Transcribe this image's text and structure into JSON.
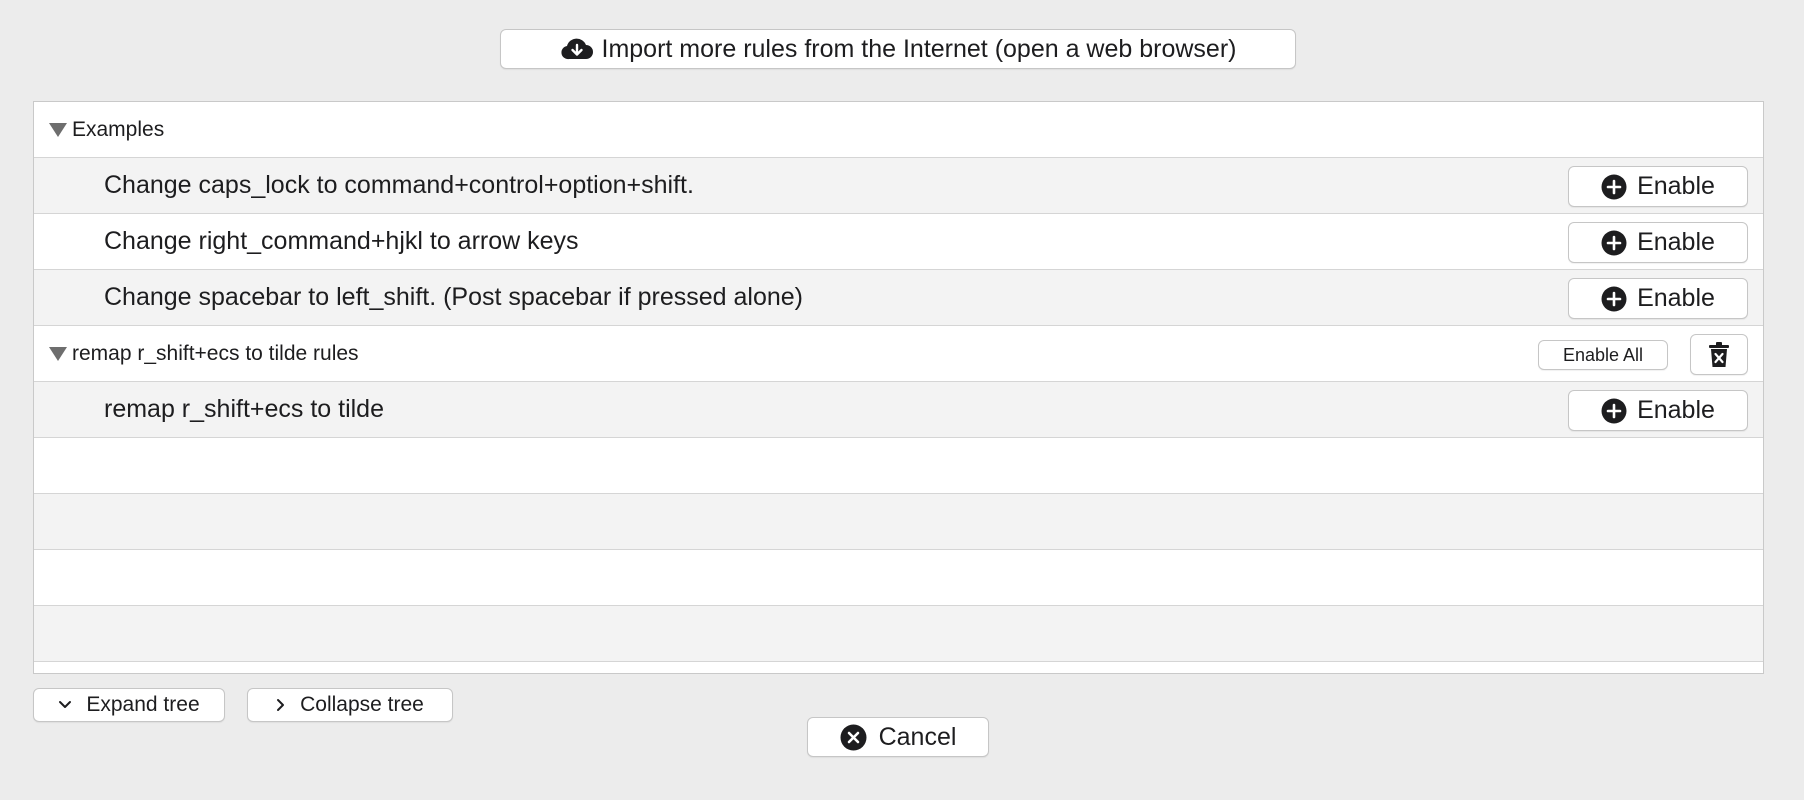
{
  "header": {
    "import_label": "Import more rules from the Internet (open a web browser)",
    "import_icon": "cloud-download-icon"
  },
  "groups": [
    {
      "title": "Examples",
      "rules": [
        {
          "label": "Change caps_lock to command+control+option+shift.",
          "button": "Enable"
        },
        {
          "label": "Change right_command+hjkl to arrow keys",
          "button": "Enable"
        },
        {
          "label": "Change spacebar to left_shift. (Post spacebar if pressed alone)",
          "button": "Enable"
        }
      ]
    },
    {
      "title": "remap r_shift+ecs to tilde rules",
      "enable_all_label": "Enable All",
      "rules": [
        {
          "label": "remap r_shift+ecs to tilde",
          "button": "Enable"
        }
      ]
    }
  ],
  "footer": {
    "expand_label": "Expand tree",
    "collapse_label": "Collapse tree",
    "cancel_label": "Cancel"
  }
}
